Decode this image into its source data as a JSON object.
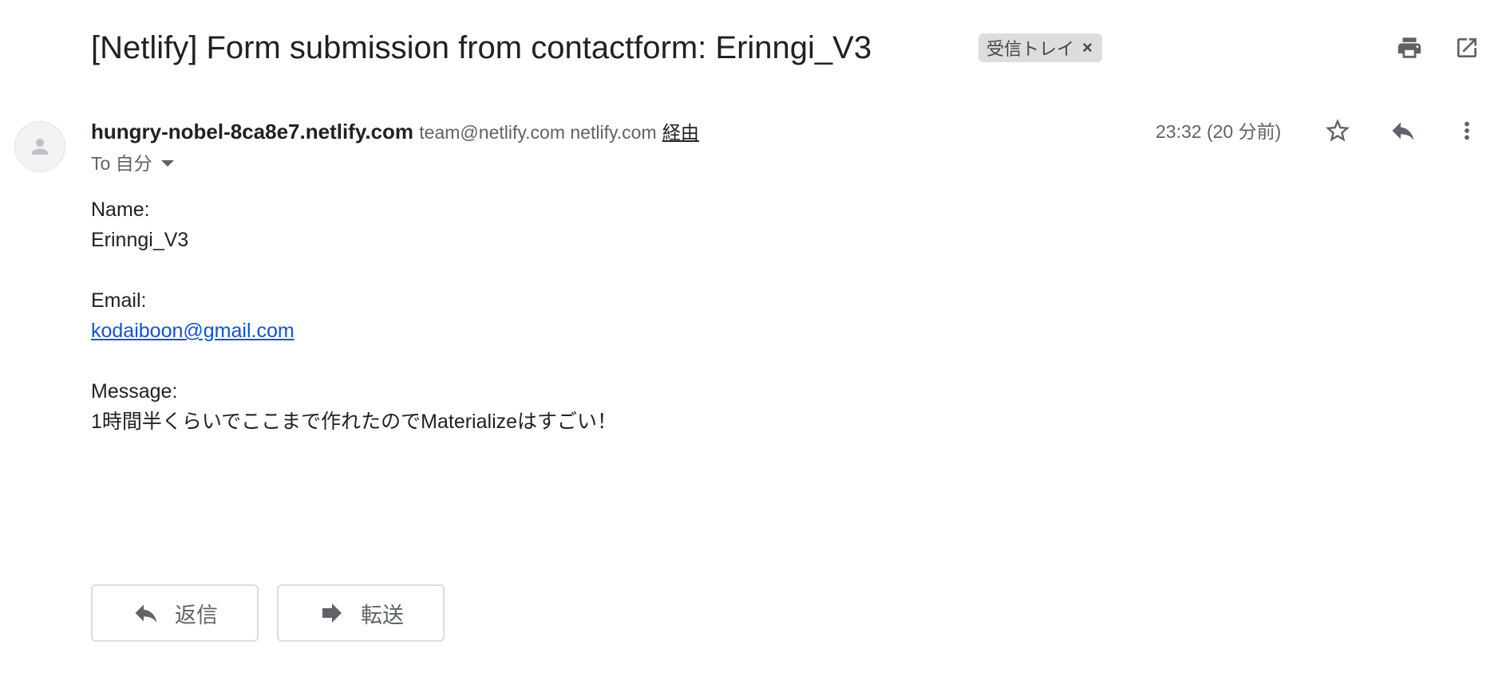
{
  "subject": {
    "title": "[Netlify] Form submission from contactform: Erinngi_V3",
    "label_chip": "受信トレイ",
    "label_chip_close": "×"
  },
  "toolbar_icons": [
    "print-icon",
    "open-in-new-window-icon"
  ],
  "sender": {
    "name": "hungry-nobel-8ca8e7.netlify.com",
    "via_address": "team@netlify.com netlify.com",
    "via_label": "経由",
    "to_label": "To 自分",
    "timestamp": "23:32 (20 分前)"
  },
  "header_icons": [
    "star-icon",
    "reply-icon",
    "more-vert-icon"
  ],
  "body": {
    "name_label": "Name:",
    "name_value": "Erinngi_V3",
    "email_label": "Email:",
    "email_value": "kodaiboon@gmail.com",
    "message_label": "Message:",
    "message_value": "1時間半くらいでここまで作れたのでMaterializeはすごい！"
  },
  "actions": {
    "reply_label": "返信",
    "forward_label": "転送"
  },
  "colors": {
    "link": "#1155cc",
    "icon_grey": "#5f6368",
    "chip_bg": "#dddddd"
  }
}
